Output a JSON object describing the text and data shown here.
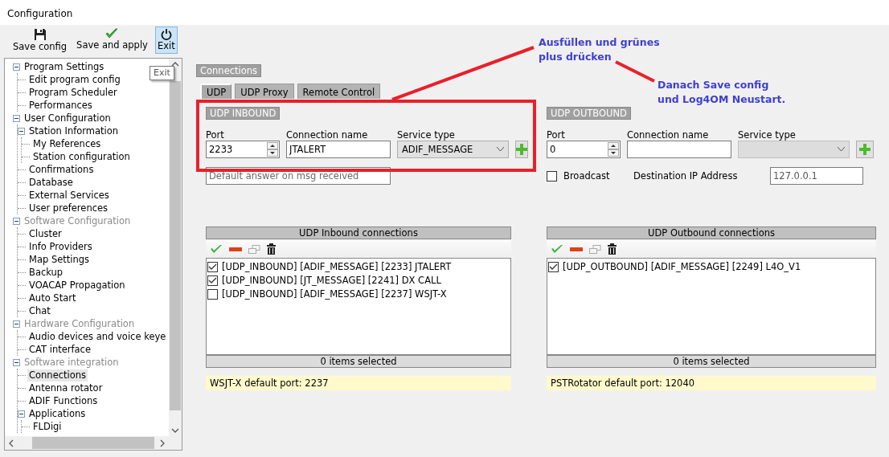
{
  "window": {
    "title": "Configuration"
  },
  "toolbar": [
    {
      "label": "Save config",
      "selected": false
    },
    {
      "label": "Save and apply",
      "selected": false
    },
    {
      "label": "Exit",
      "selected": true
    }
  ],
  "tooltip": "Exit",
  "tree": [
    {
      "label": "Program Settings",
      "expanded": true,
      "disabled": false,
      "selected": false,
      "children": [
        {
          "label": "Edit program config",
          "selected": false
        },
        {
          "label": "Program Scheduler",
          "selected": false
        },
        {
          "label": "Performances",
          "selected": false
        }
      ]
    },
    {
      "label": "User Configuration",
      "expanded": true,
      "disabled": false,
      "selected": false,
      "children": [
        {
          "label": "Station Information",
          "expanded": true,
          "selected": false,
          "children": [
            {
              "label": "My References",
              "selected": false
            },
            {
              "label": "Station configuration",
              "selected": false
            }
          ]
        },
        {
          "label": "Confirmations",
          "selected": false
        },
        {
          "label": "Database",
          "selected": false
        },
        {
          "label": "External Services",
          "selected": false
        },
        {
          "label": "User preferences",
          "selected": false
        }
      ]
    },
    {
      "label": "Software Configuration",
      "expanded": true,
      "disabled": true,
      "selected": false,
      "children": [
        {
          "label": "Cluster",
          "selected": false
        },
        {
          "label": "Info Providers",
          "selected": false
        },
        {
          "label": "Map Settings",
          "selected": false
        },
        {
          "label": "Backup",
          "selected": false
        },
        {
          "label": "VOACAP Propagation",
          "selected": false
        },
        {
          "label": "Auto Start",
          "selected": false
        },
        {
          "label": "Chat",
          "selected": false
        }
      ]
    },
    {
      "label": "Hardware Configuration",
      "expanded": true,
      "disabled": true,
      "selected": false,
      "children": [
        {
          "label": "Audio devices and voice keye",
          "selected": false
        },
        {
          "label": "CAT interface",
          "selected": false
        }
      ]
    },
    {
      "label": "Software integration",
      "expanded": true,
      "disabled": true,
      "selected": false,
      "children": [
        {
          "label": "Connections",
          "selected": true
        },
        {
          "label": "Antenna rotator",
          "selected": false
        },
        {
          "label": "ADIF Functions",
          "selected": false
        },
        {
          "label": "Applications",
          "expanded": true,
          "selected": false,
          "children": [
            {
              "label": "FLDigi",
              "selected": false
            }
          ]
        }
      ]
    }
  ],
  "section_title": "Connections",
  "tabs": [
    {
      "label": "UDP",
      "selected": true
    },
    {
      "label": "UDP Proxy",
      "selected": false
    },
    {
      "label": "Remote Control",
      "selected": false
    }
  ],
  "groups": [
    {
      "kind": "inbound",
      "title": "UDP INBOUND",
      "port_label": "Port",
      "port": "2233",
      "name_label": "Connection name",
      "name": "JTALERT",
      "service_label": "Service type",
      "service": "ADIF_MESSAGE",
      "service_disabled": false,
      "answer_placeholder": "Default answer on msg received"
    },
    {
      "kind": "outbound",
      "title": "UDP OUTBOUND",
      "port_label": "Port",
      "port": "0",
      "name_label": "Connection name",
      "service_label": "Service type",
      "service_disabled": true,
      "broadcast": {
        "label": "Broadcast",
        "checked": false
      },
      "destination_label": "Destination IP Address",
      "destination": "127.0.0.1"
    }
  ],
  "lists": [
    {
      "title": "UDP Inbound connections",
      "items": [
        {
          "text": "[UDP_INBOUND] [ADIF_MESSAGE] [2233] JTALERT",
          "checked": true
        },
        {
          "text": "[UDP_INBOUND] [JT_MESSAGE] [2241] DX CALL",
          "checked": true
        },
        {
          "text": "[UDP_INBOUND] [ADIF_MESSAGE] [2237] WSJT-X",
          "checked": false
        }
      ],
      "footer": "0 items selected",
      "note": "WSJT-X default port: 2237"
    },
    {
      "title": "UDP Outbound connections",
      "items": [
        {
          "text": "[UDP_OUTBOUND] [ADIF_MESSAGE] [2249] L4O_V1",
          "checked": true
        }
      ],
      "footer": "0 items selected",
      "note": "PSTRotator default port: 12040"
    }
  ],
  "annotations": [
    {
      "lines": [
        "Ausfüllen und grünes",
        "plus drücken"
      ]
    },
    {
      "lines": [
        "Danach Save config",
        "und Log4OM Neustart."
      ]
    }
  ]
}
